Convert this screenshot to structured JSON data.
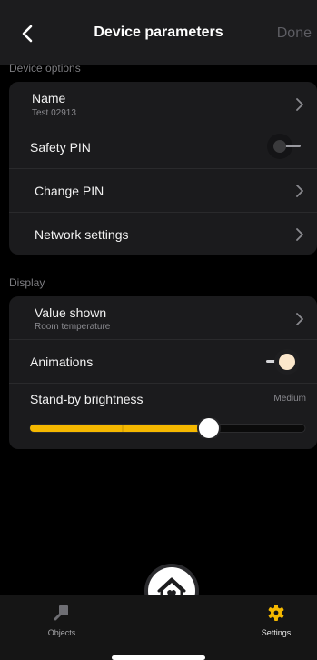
{
  "header": {
    "title": "Device parameters",
    "done_label": "Done"
  },
  "device_options": {
    "section_label": "Device options",
    "name_label": "Name",
    "name_value": "Test 02913",
    "safety_pin_label": "Safety PIN",
    "safety_pin_enabled": false,
    "change_pin_label": "Change PIN",
    "network_label": "Network settings"
  },
  "display": {
    "section_label": "Display",
    "value_shown_label": "Value shown",
    "value_shown_value": "Room temperature",
    "animations_label": "Animations",
    "animations_enabled": true,
    "brightness_label": "Stand-by brightness",
    "brightness_value": "Medium",
    "brightness_level": 0.65
  },
  "nav": {
    "objects_label": "Objects",
    "settings_label": "Settings"
  },
  "colors": {
    "accent": "#f5b800",
    "background": "#000000",
    "card": "#1b1b1d",
    "toggle_on_knob": "#fbe7cb"
  },
  "icons": {
    "back": "chevron-left-icon",
    "chevron": "chevron-right-icon",
    "objects": "objects-icon",
    "settings": "gear-icon",
    "home": "home-heart-icon"
  }
}
